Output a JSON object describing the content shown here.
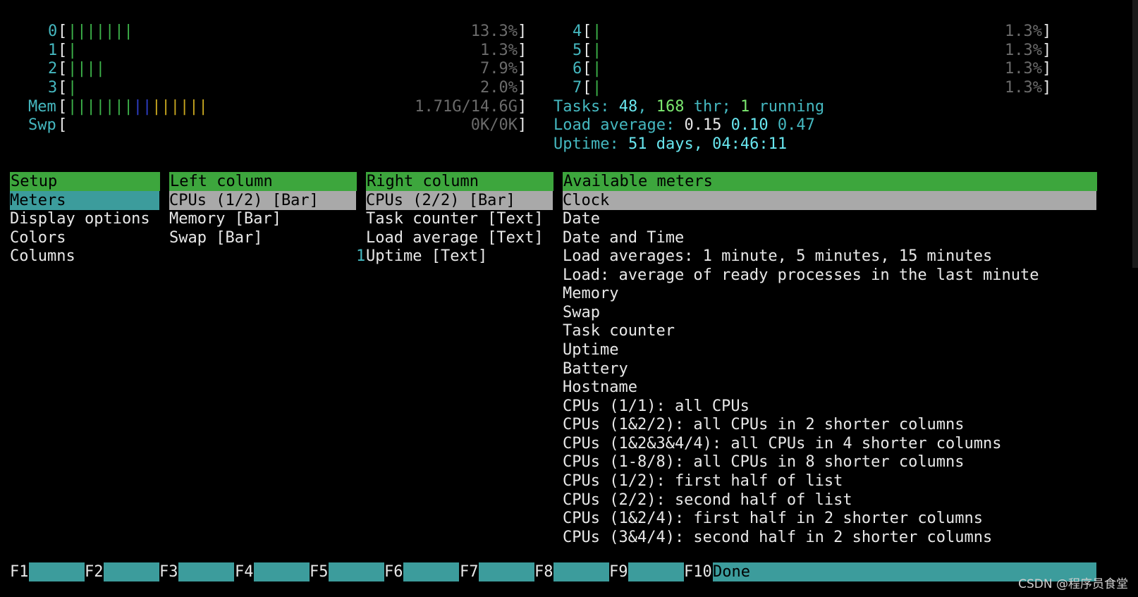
{
  "cpus_left": [
    {
      "id": "0",
      "bar": "|||||||",
      "pct": "13.3%"
    },
    {
      "id": "1",
      "bar": "|",
      "pct": "1.3%"
    },
    {
      "id": "2",
      "bar": "||||",
      "pct": "7.9%"
    },
    {
      "id": "3",
      "bar": "|",
      "pct": "2.0%"
    }
  ],
  "cpus_right": [
    {
      "id": "4",
      "bar": "|",
      "pct": "1.3%"
    },
    {
      "id": "5",
      "bar": "|",
      "pct": "1.3%"
    },
    {
      "id": "6",
      "bar": "|",
      "pct": "1.3%"
    },
    {
      "id": "7",
      "bar": "|",
      "pct": "1.3%"
    }
  ],
  "mem": {
    "label": "Mem",
    "bar_green": "|||||||",
    "bar_blue": "||",
    "bar_yellow": "||||||",
    "value": "1.71G/14.6G"
  },
  "swp": {
    "label": "Swp",
    "value": "0K/0K"
  },
  "tasks": {
    "label": "Tasks: ",
    "count": "48",
    "sep1": ", ",
    "threads": "168",
    "thr": " thr; ",
    "running": "1",
    "running_label": " running"
  },
  "load": {
    "label": "Load average: ",
    "one": "0.15",
    "five": "0.10",
    "fifteen": "0.47"
  },
  "uptime": {
    "label": "Uptime: ",
    "value": "51 days, 04:46:11"
  },
  "setup": {
    "header": "Setup",
    "items": [
      "Meters",
      "Display options",
      "Colors",
      "Columns"
    ]
  },
  "left_column": {
    "header": "Left column",
    "items": [
      "CPUs (1/2) [Bar]",
      "Memory [Bar]",
      "Swap [Bar]"
    ]
  },
  "right_column": {
    "header": "Right column",
    "items": [
      "CPUs (2/2) [Bar]",
      "Task counter [Text]",
      "Load average [Text]",
      "Uptime [Text]"
    ],
    "marker": "1"
  },
  "available_meters": {
    "header": "Available meters",
    "items": [
      "Clock",
      "Date",
      "Date and Time",
      "Load averages: 1 minute, 5 minutes, 15 minutes",
      "Load: average of ready processes in the last minute",
      "Memory",
      "Swap",
      "Task counter",
      "Uptime",
      "Battery",
      "Hostname",
      "CPUs (1/1): all CPUs",
      "CPUs (1&2/2): all CPUs in 2 shorter columns",
      "CPUs (1&2&3&4/4): all CPUs in 4 shorter columns",
      "CPUs (1-8/8): all CPUs in 8 shorter columns",
      "CPUs (1/2): first half of list",
      "CPUs (2/2): second half of list",
      "CPUs (1&2/4): first half in 2 shorter columns",
      "CPUs (3&4/4): second half in 2 shorter columns"
    ]
  },
  "function_keys": [
    {
      "key": "F1",
      "label": ""
    },
    {
      "key": "F2",
      "label": ""
    },
    {
      "key": "F3",
      "label": ""
    },
    {
      "key": "F4",
      "label": ""
    },
    {
      "key": "F5",
      "label": ""
    },
    {
      "key": "F6",
      "label": ""
    },
    {
      "key": "F7",
      "label": ""
    },
    {
      "key": "F8",
      "label": ""
    },
    {
      "key": "F9",
      "label": ""
    },
    {
      "key": "F10",
      "label": "Done"
    }
  ],
  "watermark": "CSDN @程序员食堂",
  "colors": {
    "header_green": "#3da63d",
    "selected_cyan": "#3c9c9c",
    "selected_gray": "#a9a9a9"
  }
}
